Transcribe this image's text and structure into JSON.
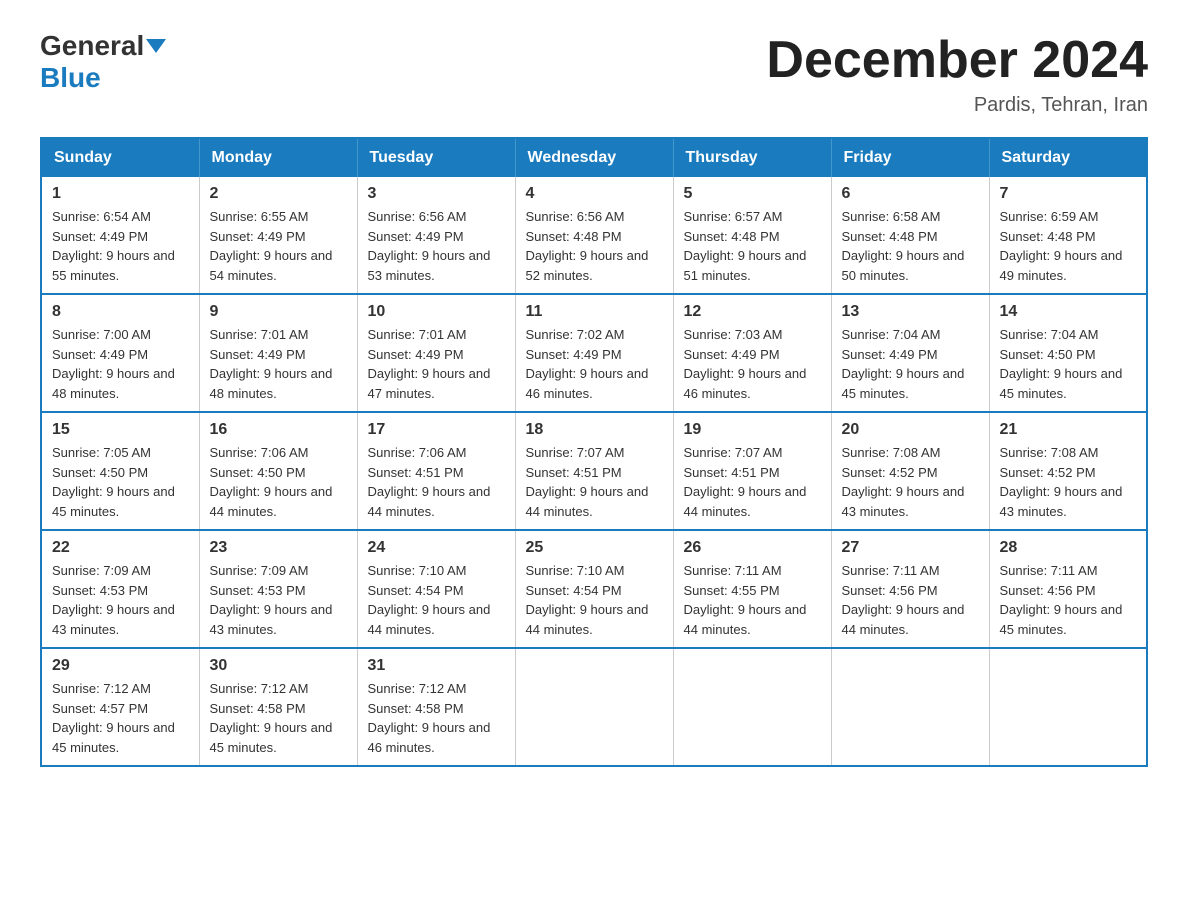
{
  "logo": {
    "general": "General",
    "blue": "Blue"
  },
  "header": {
    "title": "December 2024",
    "subtitle": "Pardis, Tehran, Iran"
  },
  "days_of_week": [
    "Sunday",
    "Monday",
    "Tuesday",
    "Wednesday",
    "Thursday",
    "Friday",
    "Saturday"
  ],
  "weeks": [
    [
      {
        "day": 1,
        "sunrise": "6:54 AM",
        "sunset": "4:49 PM",
        "daylight": "9 hours and 55 minutes."
      },
      {
        "day": 2,
        "sunrise": "6:55 AM",
        "sunset": "4:49 PM",
        "daylight": "9 hours and 54 minutes."
      },
      {
        "day": 3,
        "sunrise": "6:56 AM",
        "sunset": "4:49 PM",
        "daylight": "9 hours and 53 minutes."
      },
      {
        "day": 4,
        "sunrise": "6:56 AM",
        "sunset": "4:48 PM",
        "daylight": "9 hours and 52 minutes."
      },
      {
        "day": 5,
        "sunrise": "6:57 AM",
        "sunset": "4:48 PM",
        "daylight": "9 hours and 51 minutes."
      },
      {
        "day": 6,
        "sunrise": "6:58 AM",
        "sunset": "4:48 PM",
        "daylight": "9 hours and 50 minutes."
      },
      {
        "day": 7,
        "sunrise": "6:59 AM",
        "sunset": "4:48 PM",
        "daylight": "9 hours and 49 minutes."
      }
    ],
    [
      {
        "day": 8,
        "sunrise": "7:00 AM",
        "sunset": "4:49 PM",
        "daylight": "9 hours and 48 minutes."
      },
      {
        "day": 9,
        "sunrise": "7:01 AM",
        "sunset": "4:49 PM",
        "daylight": "9 hours and 48 minutes."
      },
      {
        "day": 10,
        "sunrise": "7:01 AM",
        "sunset": "4:49 PM",
        "daylight": "9 hours and 47 minutes."
      },
      {
        "day": 11,
        "sunrise": "7:02 AM",
        "sunset": "4:49 PM",
        "daylight": "9 hours and 46 minutes."
      },
      {
        "day": 12,
        "sunrise": "7:03 AM",
        "sunset": "4:49 PM",
        "daylight": "9 hours and 46 minutes."
      },
      {
        "day": 13,
        "sunrise": "7:04 AM",
        "sunset": "4:49 PM",
        "daylight": "9 hours and 45 minutes."
      },
      {
        "day": 14,
        "sunrise": "7:04 AM",
        "sunset": "4:50 PM",
        "daylight": "9 hours and 45 minutes."
      }
    ],
    [
      {
        "day": 15,
        "sunrise": "7:05 AM",
        "sunset": "4:50 PM",
        "daylight": "9 hours and 45 minutes."
      },
      {
        "day": 16,
        "sunrise": "7:06 AM",
        "sunset": "4:50 PM",
        "daylight": "9 hours and 44 minutes."
      },
      {
        "day": 17,
        "sunrise": "7:06 AM",
        "sunset": "4:51 PM",
        "daylight": "9 hours and 44 minutes."
      },
      {
        "day": 18,
        "sunrise": "7:07 AM",
        "sunset": "4:51 PM",
        "daylight": "9 hours and 44 minutes."
      },
      {
        "day": 19,
        "sunrise": "7:07 AM",
        "sunset": "4:51 PM",
        "daylight": "9 hours and 44 minutes."
      },
      {
        "day": 20,
        "sunrise": "7:08 AM",
        "sunset": "4:52 PM",
        "daylight": "9 hours and 43 minutes."
      },
      {
        "day": 21,
        "sunrise": "7:08 AM",
        "sunset": "4:52 PM",
        "daylight": "9 hours and 43 minutes."
      }
    ],
    [
      {
        "day": 22,
        "sunrise": "7:09 AM",
        "sunset": "4:53 PM",
        "daylight": "9 hours and 43 minutes."
      },
      {
        "day": 23,
        "sunrise": "7:09 AM",
        "sunset": "4:53 PM",
        "daylight": "9 hours and 43 minutes."
      },
      {
        "day": 24,
        "sunrise": "7:10 AM",
        "sunset": "4:54 PM",
        "daylight": "9 hours and 44 minutes."
      },
      {
        "day": 25,
        "sunrise": "7:10 AM",
        "sunset": "4:54 PM",
        "daylight": "9 hours and 44 minutes."
      },
      {
        "day": 26,
        "sunrise": "7:11 AM",
        "sunset": "4:55 PM",
        "daylight": "9 hours and 44 minutes."
      },
      {
        "day": 27,
        "sunrise": "7:11 AM",
        "sunset": "4:56 PM",
        "daylight": "9 hours and 44 minutes."
      },
      {
        "day": 28,
        "sunrise": "7:11 AM",
        "sunset": "4:56 PM",
        "daylight": "9 hours and 45 minutes."
      }
    ],
    [
      {
        "day": 29,
        "sunrise": "7:12 AM",
        "sunset": "4:57 PM",
        "daylight": "9 hours and 45 minutes."
      },
      {
        "day": 30,
        "sunrise": "7:12 AM",
        "sunset": "4:58 PM",
        "daylight": "9 hours and 45 minutes."
      },
      {
        "day": 31,
        "sunrise": "7:12 AM",
        "sunset": "4:58 PM",
        "daylight": "9 hours and 46 minutes."
      },
      null,
      null,
      null,
      null
    ]
  ]
}
